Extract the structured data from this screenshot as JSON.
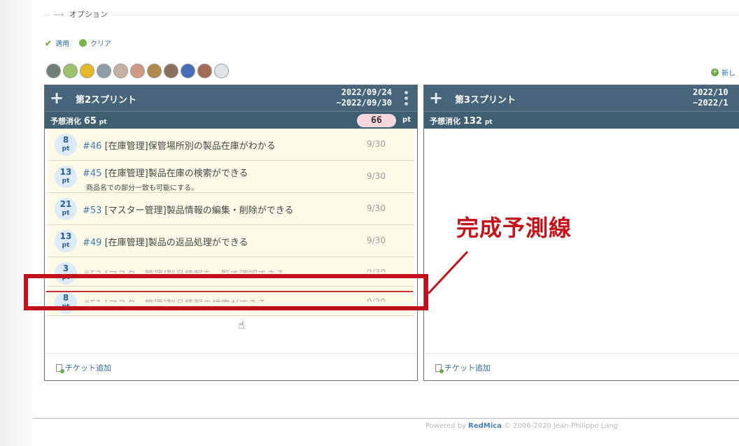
{
  "filter": {
    "legend": "オプション",
    "apply_label": "適用",
    "clear_label": "クリア"
  },
  "avatars": [
    {
      "name": "user-1",
      "color": "#6f7f76"
    },
    {
      "name": "user-2",
      "color": "#9ac36a"
    },
    {
      "name": "user-3",
      "color": "#e5b82a"
    },
    {
      "name": "user-4",
      "color": "#8d9fa4"
    },
    {
      "name": "user-5",
      "color": "#c7b0a0"
    },
    {
      "name": "user-6",
      "color": "#d09a82"
    },
    {
      "name": "user-7",
      "color": "#b2894c"
    },
    {
      "name": "user-8",
      "color": "#8b6f5d"
    },
    {
      "name": "user-9",
      "color": "#476cb8"
    },
    {
      "name": "user-10",
      "color": "#a46c58"
    },
    {
      "name": "user-11",
      "color": "#dfe4e8"
    }
  ],
  "new_link": "新し",
  "columns": [
    {
      "title": "第2スプリント",
      "date_start": "2022/09/24",
      "date_end": "~2022/09/30",
      "estimate_label": "予想消化",
      "estimate_value": "65",
      "estimate_unit": "pt",
      "count": "66",
      "count_unit": "pt",
      "add_ticket": "チケット追加"
    },
    {
      "title": "第3スプリント",
      "date_start": "2022/10",
      "date_end": "~2022/1",
      "estimate_label": "予想消化",
      "estimate_value": "132",
      "estimate_unit": "pt",
      "add_ticket": "チケット追加"
    }
  ],
  "tickets": [
    {
      "points": "8",
      "unit": "pt",
      "id": "#46",
      "title": "[在庫管理]保管場所別の製品在庫がわかる",
      "desc": "",
      "date": "9/30"
    },
    {
      "points": "13",
      "unit": "pt",
      "id": "#45",
      "title": "[在庫管理]製品在庫の検索ができる",
      "desc": "商品名での部分一致も可能にする。",
      "date": "9/30"
    },
    {
      "points": "21",
      "unit": "pt",
      "id": "#53",
      "title": "[マスター管理]製品情報の編集・削除ができる",
      "desc": "",
      "date": "9/30"
    },
    {
      "points": "13",
      "unit": "pt",
      "id": "#49",
      "title": "[在庫管理]製品の返品処理ができる",
      "desc": "",
      "date": "9/30"
    },
    {
      "points": "3",
      "unit": "pt",
      "id": "#52",
      "title": "[マスター管理]製品情報を一覧で確認できる",
      "desc": "",
      "date": "9/30"
    },
    {
      "points": "8",
      "unit": "pt",
      "id": "#51",
      "title": "[マスター管理]製品情報の検索ができる",
      "desc": "",
      "date": "9/30"
    }
  ],
  "annotation": {
    "label": "完成予測線",
    "color": "#c4121b"
  },
  "footer": {
    "prefix": "Powered by ",
    "brand": "RedMica",
    "suffix": " © 2006-2020 Jean-Philippe Lang"
  }
}
